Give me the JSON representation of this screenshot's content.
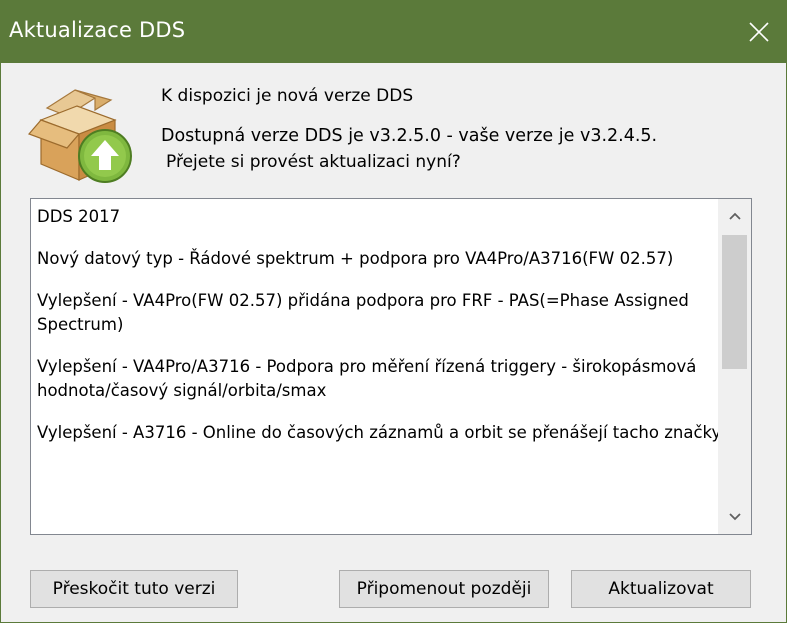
{
  "window": {
    "title": "Aktualizace DDS",
    "title_color": "#5b7a3a"
  },
  "icons": {
    "app": "package-update-icon",
    "close": "close-icon",
    "scroll_up": "chevron-up-icon",
    "scroll_down": "chevron-down-icon"
  },
  "message": {
    "line1": "K dispozici je nová verze DDS",
    "line2": "Dostupná verze DDS je v3.2.5.0 - vaše verze je v3.2.4.5.",
    "line3": "Přejete si provést aktualizaci nyní?"
  },
  "release_notes": {
    "items": [
      "DDS 2017",
      "Nový datový typ - Řádové spektrum + podpora pro VA4Pro/A3716(FW 02.57)",
      "Vylepšení - VA4Pro(FW 02.57) přidána podpora pro FRF - PAS(=Phase Assigned Spectrum)",
      "Vylepšení - VA4Pro/A3716 - Podpora pro měření řízená triggery - širokopásmová hodnota/časový signál/orbita/smax",
      "Vylepšení - A3716 - Online do časových záznamů a orbit se přenášejí tacho značky"
    ]
  },
  "buttons": {
    "skip": "Přeskočit tuto verzi",
    "remind": "Připomenout později",
    "update": "Aktualizovat"
  }
}
